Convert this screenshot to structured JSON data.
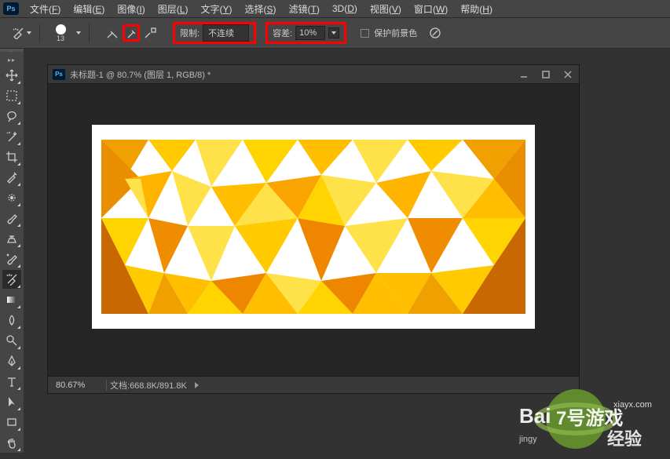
{
  "app": {
    "logo": "Ps"
  },
  "menu": {
    "items": [
      {
        "label": "文件",
        "key": "F"
      },
      {
        "label": "编辑",
        "key": "E"
      },
      {
        "label": "图像",
        "key": "I"
      },
      {
        "label": "图层",
        "key": "L"
      },
      {
        "label": "文字",
        "key": "Y"
      },
      {
        "label": "选择",
        "key": "S"
      },
      {
        "label": "滤镜",
        "key": "T"
      },
      {
        "label": "3D",
        "key": "D"
      },
      {
        "label": "视图",
        "key": "V"
      },
      {
        "label": "窗口",
        "key": "W"
      },
      {
        "label": "帮助",
        "key": "H"
      }
    ]
  },
  "options": {
    "brush_size": "13",
    "limit_label": "限制:",
    "limit_value": "不连续",
    "tolerance_label": "容差:",
    "tolerance_value": "10%",
    "protect_fg_label": "保护前景色"
  },
  "tools": [
    "move",
    "marquee",
    "lasso",
    "magic-wand",
    "crop",
    "eyedropper",
    "spot-heal",
    "brush",
    "clone-stamp",
    "history-brush",
    "eraser",
    "gradient",
    "blur",
    "dodge",
    "pen",
    "type",
    "path-select",
    "rectangle",
    "hand"
  ],
  "document": {
    "title": "未标题-1 @ 80.7% (图层 1, RGB/8) *",
    "zoom": "80.67%",
    "status_label": "文档:",
    "status_value": "668.8K/891.8K"
  },
  "watermark": {
    "text1": "Bai",
    "text2": "7号游戏",
    "text3": "经验",
    "url": "xiayx.com",
    "sub": "jingy"
  }
}
